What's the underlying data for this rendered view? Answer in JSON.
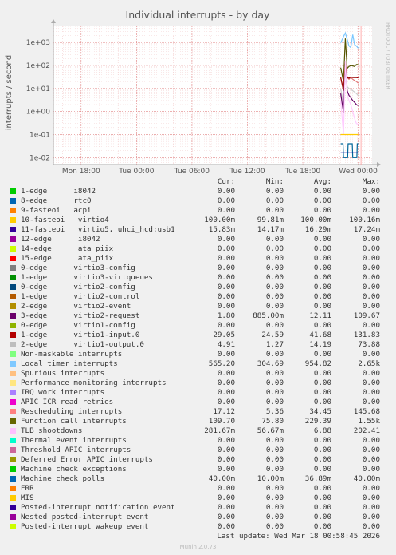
{
  "chart_data": {
    "type": "line",
    "title": "Individual interrupts - by day",
    "ylabel": "interrupts / second",
    "side_label": "RRDTOOL / TOBI OETIKER",
    "yscale": "log",
    "ylim": [
      0.005,
      5000
    ],
    "y_ticks": [
      "1e-02",
      "1e-01",
      "1e+00",
      "1e+01",
      "1e+02",
      "1e+03"
    ],
    "x_ticks": [
      "Mon 18:00",
      "Tue 00:00",
      "Tue 06:00",
      "Tue 12:00",
      "Tue 18:00",
      "Wed 00:00"
    ],
    "x_range_hours": [
      -33,
      1.5
    ],
    "data_start_hours": -1.9,
    "grid": true,
    "series": [
      {
        "name": "Local timer interrupts",
        "color": "#7ac7ff",
        "x": [
          -1.9,
          -1.6,
          -1.4,
          -1.2,
          -1.0,
          -0.8,
          -0.6,
          -0.4,
          -0.2,
          0.0
        ],
        "y": [
          950,
          1800,
          2600,
          1400,
          700,
          600,
          2200,
          800,
          700,
          565
        ]
      },
      {
        "name": "Function call interrupts",
        "color": "#555500",
        "x": [
          -1.9,
          -1.6,
          -1.4,
          -1.2,
          -1.0,
          -0.8,
          -0.6,
          -0.4,
          -0.2,
          0.0
        ],
        "y": [
          80,
          20,
          1500,
          75,
          90,
          100,
          95,
          90,
          110,
          110
        ]
      },
      {
        "name": "Rescheduling interrupts",
        "color": "#e17a7a",
        "x": [
          -1.9,
          -1.6,
          -1.4,
          -1.2,
          -1.0,
          -0.8,
          -0.6,
          -0.4,
          -0.2,
          0.0
        ],
        "y": [
          30,
          9,
          140,
          30,
          25,
          30,
          25,
          22,
          20,
          17
        ]
      },
      {
        "name": "1-edge virtio1-input.0",
        "color": "#990000",
        "x": [
          -1.9,
          -1.6,
          -1.4,
          -1.2,
          -1.0,
          -0.8,
          -0.6,
          -0.4,
          -0.2,
          0.0
        ],
        "y": [
          30,
          8,
          120,
          30,
          28,
          32,
          30,
          30,
          30,
          29
        ]
      },
      {
        "name": "2-edge virtio1-output.0",
        "color": "#cccccc",
        "x": [
          -1.9,
          -1.6,
          -1.4,
          -1.2,
          -1.0,
          -0.8,
          -0.6,
          -0.4,
          -0.2,
          0.0
        ],
        "y": [
          10,
          2,
          60,
          12,
          10,
          9,
          8,
          7,
          6,
          5
        ]
      },
      {
        "name": "3-edge virtio2-request",
        "color": "#660066",
        "x": [
          -1.9,
          -1.6,
          -1.4,
          -1.2,
          -1.0,
          -0.8,
          -0.6,
          -0.4,
          -0.2,
          0.0
        ],
        "y": [
          6,
          0.9,
          100,
          8,
          5,
          4,
          3,
          2.5,
          2,
          1.8
        ]
      },
      {
        "name": "TLB shootdowns",
        "color": "#ffccff",
        "x": [
          -1.9,
          -1.6,
          -1.4,
          -1.2,
          -1.0,
          -0.8,
          -0.6,
          -0.4,
          -0.2,
          0.0
        ],
        "y": [
          3,
          0.1,
          150,
          5,
          3,
          2,
          1,
          0.5,
          0.3,
          0.28
        ]
      },
      {
        "name": "10-fasteoi virtio4",
        "color": "#ffcc00",
        "x": [
          -1.9,
          -1.0,
          0.0
        ],
        "y": [
          0.1,
          0.1,
          0.1
        ]
      },
      {
        "name": "Machine check polls",
        "color": "#006699",
        "x": [
          -1.9,
          -1.65,
          -1.6,
          -1.15,
          -1.1,
          -0.65,
          -0.6,
          -0.15,
          -0.1,
          0.0
        ],
        "y": [
          0.04,
          0.04,
          0.01,
          0.01,
          0.04,
          0.04,
          0.01,
          0.01,
          0.04,
          0.04
        ]
      },
      {
        "name": "11-fasteoi virtio5, uhci_hcd:usb1",
        "color": "#000099",
        "x": [
          -1.9,
          -1.0,
          0.0
        ],
        "y": [
          0.016,
          0.016,
          0.016
        ]
      }
    ]
  },
  "legend": {
    "headers": {
      "cur": "Cur:",
      "min": "Min:",
      "avg": "Avg:",
      "max": "Max:"
    },
    "rows": [
      {
        "name": "1-edge      i8042",
        "color": "#00cc00",
        "cur": "0.00",
        "min": "0.00",
        "avg": "0.00",
        "max": "0.00"
      },
      {
        "name": "8-edge      rtc0",
        "color": "#0066b3",
        "cur": "0.00",
        "min": "0.00",
        "avg": "0.00",
        "max": "0.00"
      },
      {
        "name": "9-fasteoi   acpi",
        "color": "#ff8000",
        "cur": "0.00",
        "min": "0.00",
        "avg": "0.00",
        "max": "0.00"
      },
      {
        "name": "10-fasteoi   virtio4",
        "color": "#ffcc00",
        "cur": "100.00m",
        "min": "99.81m",
        "avg": "100.00m",
        "max": "100.16m"
      },
      {
        "name": "11-fasteoi   virtio5, uhci_hcd:usb1",
        "color": "#330099",
        "cur": "15.83m",
        "min": "14.17m",
        "avg": "16.29m",
        "max": "17.24m"
      },
      {
        "name": "12-edge      i8042",
        "color": "#990099",
        "cur": "0.00",
        "min": "0.00",
        "avg": "0.00",
        "max": "0.00"
      },
      {
        "name": "14-edge      ata_piix",
        "color": "#ccff00",
        "cur": "0.00",
        "min": "0.00",
        "avg": "0.00",
        "max": "0.00"
      },
      {
        "name": "15-edge      ata_piix",
        "color": "#ff0000",
        "cur": "0.00",
        "min": "0.00",
        "avg": "0.00",
        "max": "0.00"
      },
      {
        "name": "0-edge      virtio3-config",
        "color": "#808080",
        "cur": "0.00",
        "min": "0.00",
        "avg": "0.00",
        "max": "0.00"
      },
      {
        "name": "1-edge      virtio3-virtqueues",
        "color": "#008f00",
        "cur": "0.00",
        "min": "0.00",
        "avg": "0.00",
        "max": "0.00"
      },
      {
        "name": "0-edge      virtio2-config",
        "color": "#00487d",
        "cur": "0.00",
        "min": "0.00",
        "avg": "0.00",
        "max": "0.00"
      },
      {
        "name": "1-edge      virtio2-control",
        "color": "#b35a00",
        "cur": "0.00",
        "min": "0.00",
        "avg": "0.00",
        "max": "0.00"
      },
      {
        "name": "2-edge      virtio2-event",
        "color": "#b38f00",
        "cur": "0.00",
        "min": "0.00",
        "avg": "0.00",
        "max": "0.00"
      },
      {
        "name": "3-edge      virtio2-request",
        "color": "#6b006b",
        "cur": "1.80",
        "min": "885.00m",
        "avg": "12.11",
        "max": "109.67"
      },
      {
        "name": "0-edge      virtio1-config",
        "color": "#8fb300",
        "cur": "0.00",
        "min": "0.00",
        "avg": "0.00",
        "max": "0.00"
      },
      {
        "name": "1-edge      virtio1-input.0",
        "color": "#b30000",
        "cur": "29.05",
        "min": "24.59",
        "avg": "41.68",
        "max": "131.83"
      },
      {
        "name": "2-edge      virtio1-output.0",
        "color": "#bebebe",
        "cur": "4.91",
        "min": "1.27",
        "avg": "14.19",
        "max": "73.88"
      },
      {
        "name": "Non-maskable interrupts",
        "color": "#80ff80",
        "cur": "0.00",
        "min": "0.00",
        "avg": "0.00",
        "max": "0.00"
      },
      {
        "name": "Local timer interrupts",
        "color": "#80c9ff",
        "cur": "565.20",
        "min": "304.69",
        "avg": "954.82",
        "max": "2.65k"
      },
      {
        "name": "Spurious interrupts",
        "color": "#ffc080",
        "cur": "0.00",
        "min": "0.00",
        "avg": "0.00",
        "max": "0.00"
      },
      {
        "name": "Performance monitoring interrupts",
        "color": "#ffe680",
        "cur": "0.00",
        "min": "0.00",
        "avg": "0.00",
        "max": "0.00"
      },
      {
        "name": "IRQ work interrupts",
        "color": "#aa80ff",
        "cur": "0.00",
        "min": "0.00",
        "avg": "0.00",
        "max": "0.00"
      },
      {
        "name": "APIC ICR read retries",
        "color": "#ee00cc",
        "cur": "0.00",
        "min": "0.00",
        "avg": "0.00",
        "max": "0.00"
      },
      {
        "name": "Rescheduling interrupts",
        "color": "#ff8080",
        "cur": "17.12",
        "min": "5.36",
        "avg": "34.45",
        "max": "145.68"
      },
      {
        "name": "Function call interrupts",
        "color": "#666600",
        "cur": "109.70",
        "min": "75.80",
        "avg": "229.39",
        "max": "1.55k"
      },
      {
        "name": "TLB shootdowns",
        "color": "#ffbfff",
        "cur": "281.67m",
        "min": "56.67m",
        "avg": "6.88",
        "max": "202.41"
      },
      {
        "name": "Thermal event interrupts",
        "color": "#00ffcc",
        "cur": "0.00",
        "min": "0.00",
        "avg": "0.00",
        "max": "0.00"
      },
      {
        "name": "Threshold APIC interrupts",
        "color": "#cc6699",
        "cur": "0.00",
        "min": "0.00",
        "avg": "0.00",
        "max": "0.00"
      },
      {
        "name": "Deferred Error APIC interrupts",
        "color": "#999900",
        "cur": "0.00",
        "min": "0.00",
        "avg": "0.00",
        "max": "0.00"
      },
      {
        "name": "Machine check exceptions",
        "color": "#00cc00",
        "cur": "0.00",
        "min": "0.00",
        "avg": "0.00",
        "max": "0.00"
      },
      {
        "name": "Machine check polls",
        "color": "#0066b3",
        "cur": "40.00m",
        "min": "10.00m",
        "avg": "36.89m",
        "max": "40.00m"
      },
      {
        "name": "ERR",
        "color": "#ff8000",
        "cur": "0.00",
        "min": "0.00",
        "avg": "0.00",
        "max": "0.00"
      },
      {
        "name": "MIS",
        "color": "#ffcc00",
        "cur": "0.00",
        "min": "0.00",
        "avg": "0.00",
        "max": "0.00"
      },
      {
        "name": "Posted-interrupt notification event",
        "color": "#330099",
        "cur": "0.00",
        "min": "0.00",
        "avg": "0.00",
        "max": "0.00"
      },
      {
        "name": "Nested posted-interrupt event",
        "color": "#990099",
        "cur": "0.00",
        "min": "0.00",
        "avg": "0.00",
        "max": "0.00"
      },
      {
        "name": "Posted-interrupt wakeup event",
        "color": "#ccff00",
        "cur": "0.00",
        "min": "0.00",
        "avg": "0.00",
        "max": "0.00"
      }
    ]
  },
  "last_update": "Last update: Wed Mar 18 00:58:45 2026",
  "footer": "Munin 2.0.73"
}
